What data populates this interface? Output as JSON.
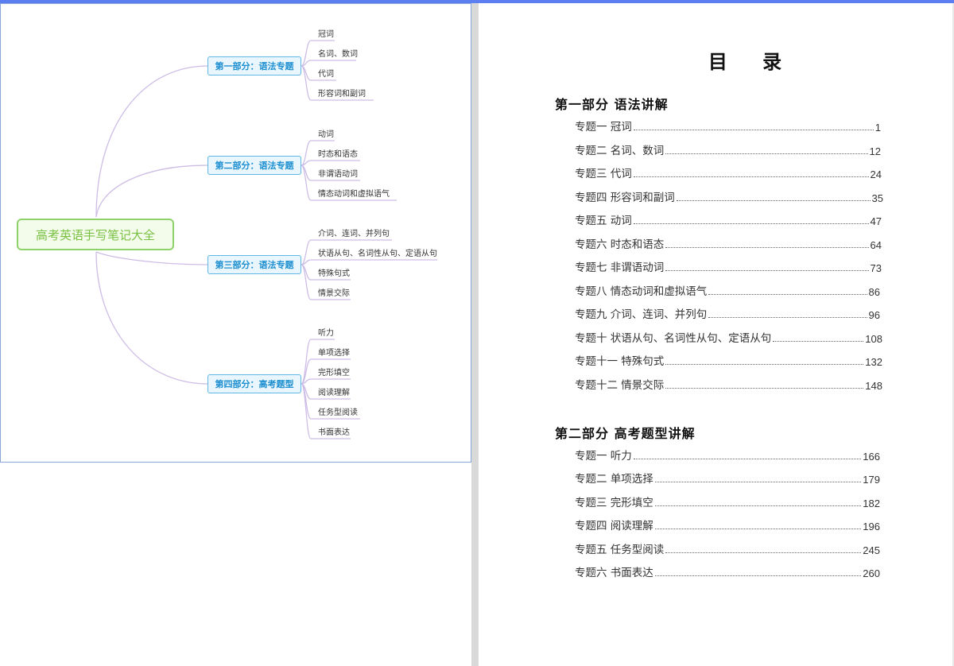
{
  "mindmap": {
    "root": "高考英语手写笔记大全",
    "parts": [
      {
        "label": "第一部分：语法专题",
        "leaves": [
          "冠词",
          "名词、数词",
          "代词",
          "形容词和副词"
        ]
      },
      {
        "label": "第二部分：语法专题",
        "leaves": [
          "动词",
          "时态和语态",
          "非谓语动词",
          "情态动词和虚拟语气"
        ]
      },
      {
        "label": "第三部分：语法专题",
        "leaves": [
          "介词、连词、并列句",
          "状语从句、名词性从句、定语从句",
          "特殊句式",
          "情景交际"
        ]
      },
      {
        "label": "第四部分：高考题型",
        "leaves": [
          "听力",
          "单项选择",
          "完形填空",
          "阅读理解",
          "任务型阅读",
          "书面表达"
        ]
      }
    ]
  },
  "toc": {
    "title": "目 录",
    "sections": [
      {
        "title": "第一部分  语法讲解",
        "items": [
          {
            "label": "专题一  冠词",
            "page": "1"
          },
          {
            "label": "专题二  名词、数词",
            "page": "12"
          },
          {
            "label": "专题三  代词",
            "page": "24"
          },
          {
            "label": "专题四  形容词和副词",
            "page": "35"
          },
          {
            "label": "专题五  动词",
            "page": "47"
          },
          {
            "label": "专题六  时态和语态",
            "page": "64"
          },
          {
            "label": "专题七  非谓语动词",
            "page": "73"
          },
          {
            "label": "专题八  情态动词和虚拟语气",
            "page": "86"
          },
          {
            "label": "专题九  介词、连词、并列句",
            "page": "96"
          },
          {
            "label": "专题十  状语从句、名词性从句、定语从句",
            "page": "108"
          },
          {
            "label": "专题十一  特殊句式",
            "page": "132"
          },
          {
            "label": "专题十二  情景交际",
            "page": "148"
          }
        ]
      },
      {
        "title": "第二部分  高考题型讲解",
        "items": [
          {
            "label": "专题一  听力",
            "page": "166"
          },
          {
            "label": "专题二  单项选择",
            "page": "179"
          },
          {
            "label": "专题三  完形填空",
            "page": "182"
          },
          {
            "label": "专题四  阅读理解",
            "page": "196"
          },
          {
            "label": "专题五  任务型阅读",
            "page": "245"
          },
          {
            "label": "专题六  书面表达",
            "page": "260"
          }
        ]
      }
    ]
  }
}
